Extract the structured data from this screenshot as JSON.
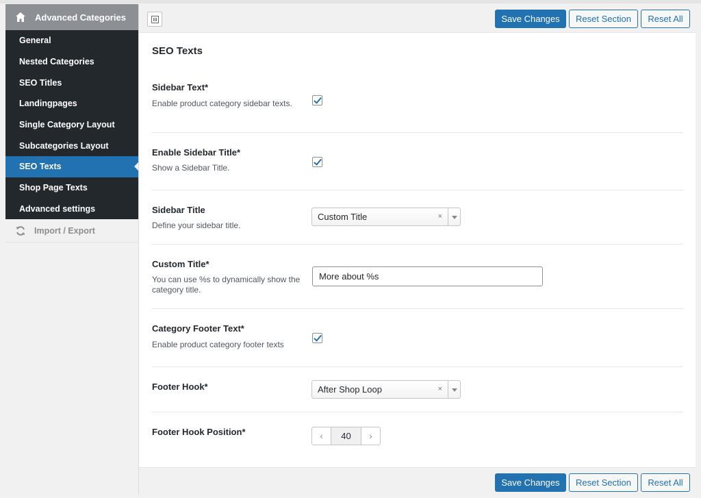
{
  "sidebar": {
    "header_label": "Advanced Categories",
    "items": [
      {
        "label": "General"
      },
      {
        "label": "Nested Categories"
      },
      {
        "label": "SEO Titles"
      },
      {
        "label": "Landingpages"
      },
      {
        "label": "Single Category Layout"
      },
      {
        "label": "Subcategories Layout"
      },
      {
        "label": "SEO Texts",
        "active": true
      },
      {
        "label": "Shop Page Texts"
      },
      {
        "label": "Advanced settings"
      }
    ],
    "import_export_label": "Import / Export"
  },
  "toolbar": {
    "save_label": "Save Changes",
    "reset_section_label": "Reset Section",
    "reset_all_label": "Reset All"
  },
  "section": {
    "title": "SEO Texts",
    "fields": {
      "sidebar_text": {
        "title": "Sidebar Text*",
        "desc": "Enable product category sidebar texts.",
        "checked": true
      },
      "enable_sidebar_title": {
        "title": "Enable Sidebar Title*",
        "desc": "Show a Sidebar Title.",
        "checked": true
      },
      "sidebar_title": {
        "title": "Sidebar Title",
        "desc": "Define your sidebar title.",
        "value": "Custom Title"
      },
      "custom_title": {
        "title": "Custom Title*",
        "desc": "You can use %s to dynamically show the category title.",
        "value": "More about %s"
      },
      "category_footer_text": {
        "title": "Category Footer Text*",
        "desc": "Enable product category footer texts",
        "checked": true
      },
      "footer_hook": {
        "title": "Footer Hook*",
        "value": "After Shop Loop"
      },
      "footer_hook_position": {
        "title": "Footer Hook Position*",
        "value": "40"
      }
    }
  },
  "colors": {
    "primary": "#2271b1",
    "sidebar_bg": "#23282d",
    "header_bg": "#8c8f94"
  },
  "icons": {
    "header": "home-icon",
    "import": "refresh-icon",
    "clear": "×",
    "prev": "‹",
    "next": "›"
  }
}
